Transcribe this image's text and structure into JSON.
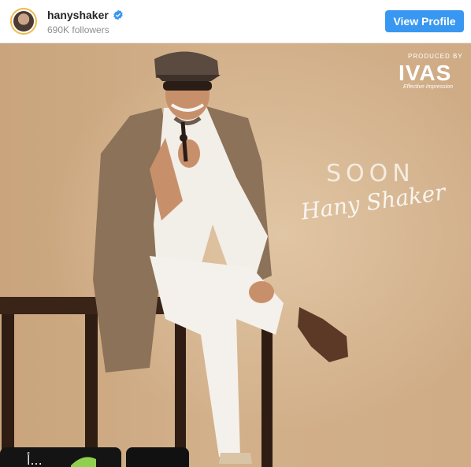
{
  "profile": {
    "username": "hanyshaker",
    "followers": "690K followers",
    "view_profile_label": "View Profile"
  },
  "post": {
    "produced_by": "PRODUCED BY",
    "brand": "IVAS",
    "brand_tagline": "Effective Impression",
    "soon": "SOON",
    "signature": "Hany Shaker",
    "bottom_text": "أ..."
  },
  "colors": {
    "accent": "#3897f0",
    "background": "#d2b08a"
  }
}
